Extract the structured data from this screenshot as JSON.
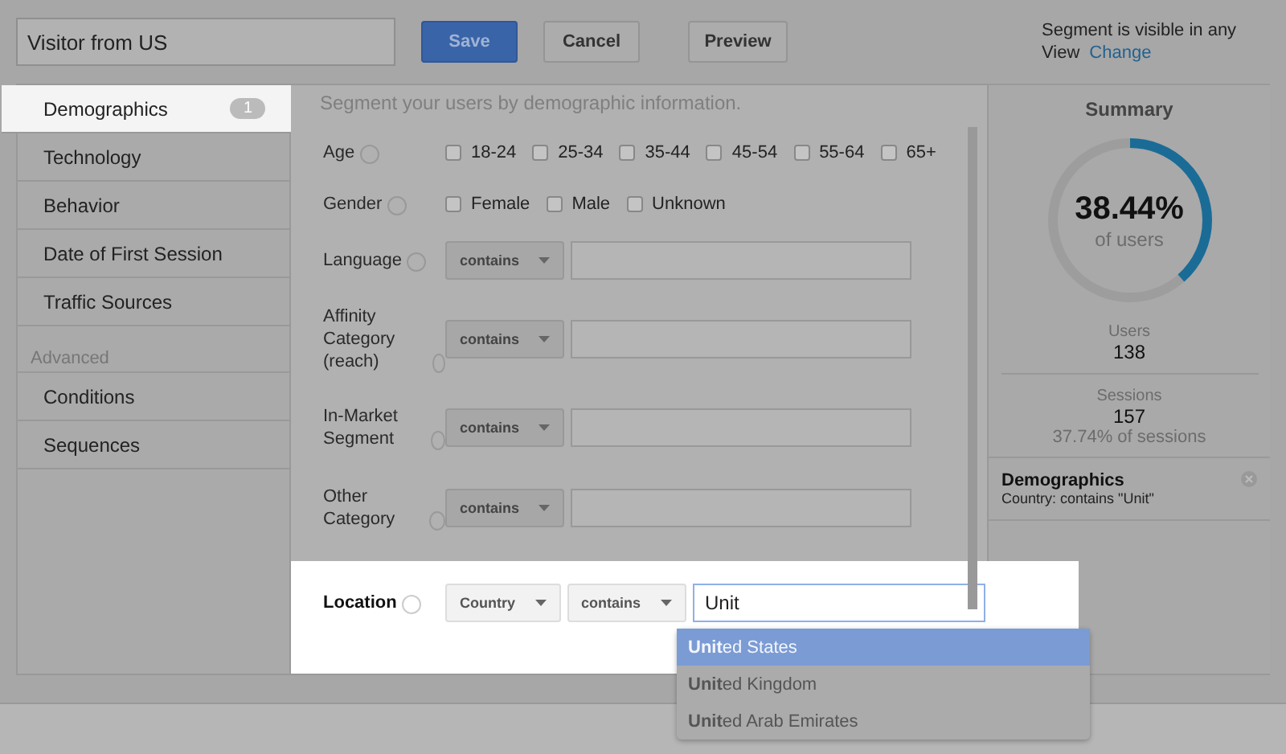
{
  "segment_name": {
    "value": "Visitor from US"
  },
  "buttons": [
    {
      "label": "Save",
      "kind": "primary"
    },
    {
      "label": "Cancel",
      "kind": "plain"
    },
    {
      "label": "Preview",
      "kind": "plain"
    }
  ],
  "visibility": {
    "text": "Segment is visible in any View",
    "link": "Change"
  },
  "sidebar": {
    "items": [
      {
        "label": "Demographics",
        "badge": "1",
        "selected": true
      },
      {
        "label": "Technology",
        "selected": false
      },
      {
        "label": "Behavior",
        "selected": false
      },
      {
        "label": "Date of First Session",
        "selected": false
      },
      {
        "label": "Traffic Sources",
        "selected": false
      }
    ],
    "advanced_label": "Advanced",
    "advanced_items": [
      {
        "label": "Conditions",
        "selected": false
      },
      {
        "label": "Sequences",
        "selected": false
      }
    ]
  },
  "intro": "Segment your users by demographic information.",
  "rows": [
    {
      "kind": "checks",
      "label": "Age",
      "options": [
        {
          "label": "18-24",
          "checked": false
        },
        {
          "label": "25-34",
          "checked": false
        },
        {
          "label": "35-44",
          "checked": false
        },
        {
          "label": "45-54",
          "checked": false
        },
        {
          "label": "55-64",
          "checked": false
        },
        {
          "label": "65+",
          "checked": false
        }
      ]
    },
    {
      "kind": "checks",
      "label": "Gender",
      "options": [
        {
          "label": "Female",
          "checked": false
        },
        {
          "label": "Male",
          "checked": false
        },
        {
          "label": "Unknown",
          "checked": false
        }
      ]
    },
    {
      "kind": "filter",
      "label": "Language",
      "selects": [
        "contains"
      ]
    },
    {
      "kind": "filter",
      "label": "Affinity Category (reach)",
      "selects": [
        "contains"
      ]
    },
    {
      "kind": "filter",
      "label": "In-Market Segment",
      "selects": [
        "contains"
      ]
    },
    {
      "kind": "filter",
      "label": "Other Category",
      "selects": [
        "contains"
      ]
    },
    {
      "kind": "filter",
      "label": "Location",
      "highlighted": true,
      "selects": [
        "Country",
        "contains"
      ],
      "value": "Unit",
      "suggestions": [
        {
          "label": "**Unit**ed States",
          "selected": true
        },
        {
          "label": "**Unit**ed Kingdom",
          "selected": false
        },
        {
          "label": "**Unit**ed Arab Emirates",
          "selected": false
        }
      ]
    }
  ],
  "summary": {
    "title": "Summary",
    "percent": "38.44%",
    "percent_caption": "of users",
    "level": 0.3844,
    "stats": [
      {
        "label": "Users",
        "value": "138"
      },
      {
        "label": "Sessions",
        "value": "157",
        "note": "37.74% of sessions"
      }
    ],
    "conditions": [
      {
        "title": "Demographics",
        "detail": "Country: contains \"Unit\""
      }
    ]
  }
}
